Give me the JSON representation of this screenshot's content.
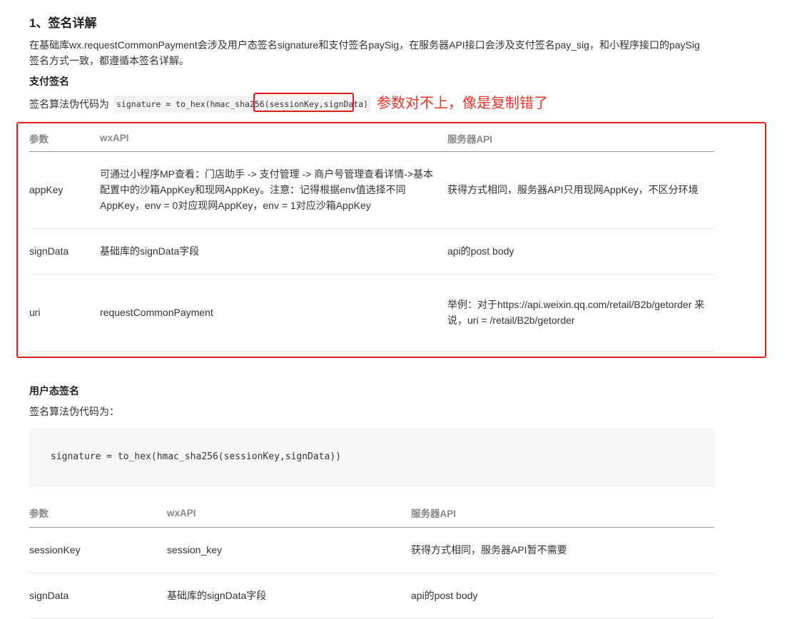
{
  "section_title": "1、签名详解",
  "intro_text": "在基础库wx.requestCommonPayment会涉及用户态签名signature和支付签名paySig，在服务器API接口会涉及支付签名pay_sig，和小程序接口的paySig签名方式一致，都遵循本签名详解。",
  "pay_sign": {
    "heading": "支付签名",
    "algo_label": "签名算法伪代码为",
    "code": "signature = to_hex(hmac_sha256(sessionKey,signData)",
    "annotation": "参数对不上，像是复制错了",
    "table": {
      "headers": [
        "参数",
        "wxAPI",
        "服务器API"
      ],
      "rows": [
        {
          "param": "appKey",
          "wx": "可通过小程序MP查看：门店助手 -> 支付管理 -> 商户号管理查看详情->基本配置中的沙箱AppKey和现网AppKey。注意：记得根据env值选择不同AppKey，env = 0对应现网AppKey，env = 1对应沙箱AppKey",
          "server": "获得方式相同，服务器API只用现网AppKey，不区分环境"
        },
        {
          "param": "signData",
          "wx": "基础库的signData字段",
          "server": "api的post body"
        },
        {
          "param": "uri",
          "wx": "requestCommonPayment",
          "server": "举例：对于https://api.weixin.qq.com/retail/B2b/getorder 来说，uri = /retail/B2b/getorder"
        }
      ]
    }
  },
  "user_sign": {
    "heading": "用户态签名",
    "algo_label": "签名算法伪代码为：",
    "code": "signature = to_hex(hmac_sha256(sessionKey,signData))",
    "table": {
      "headers": [
        "参数",
        "wxAPI",
        "服务器API"
      ],
      "rows": [
        {
          "param": "sessionKey",
          "wx": "session_key",
          "server": "获得方式相同，服务器API暂不需要"
        },
        {
          "param": "signData",
          "wx": "基础库的signData字段",
          "server": "api的post body"
        }
      ]
    }
  }
}
